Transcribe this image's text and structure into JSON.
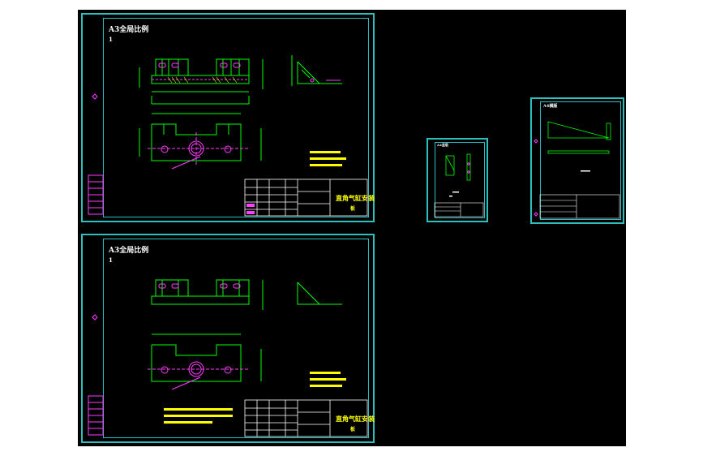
{
  "sheets": {
    "s1": {
      "title": "A3全局比例",
      "sub": "1",
      "part_title": "直角气缸安装",
      "part_sub": "板"
    },
    "s2": {
      "title": "A3全局比例",
      "sub": "1",
      "part_title": "直角气缸安装",
      "part_sub": "板"
    },
    "s3": {
      "title": "A4竖版"
    },
    "s4": {
      "title": "A4横版"
    }
  },
  "colors": {
    "background": "#000000",
    "frame": "#2bbfbf",
    "geometry": "#00ff00",
    "annotation": "#ff3cff",
    "text_yellow": "#ffff00",
    "text_white": "#ffffff"
  }
}
